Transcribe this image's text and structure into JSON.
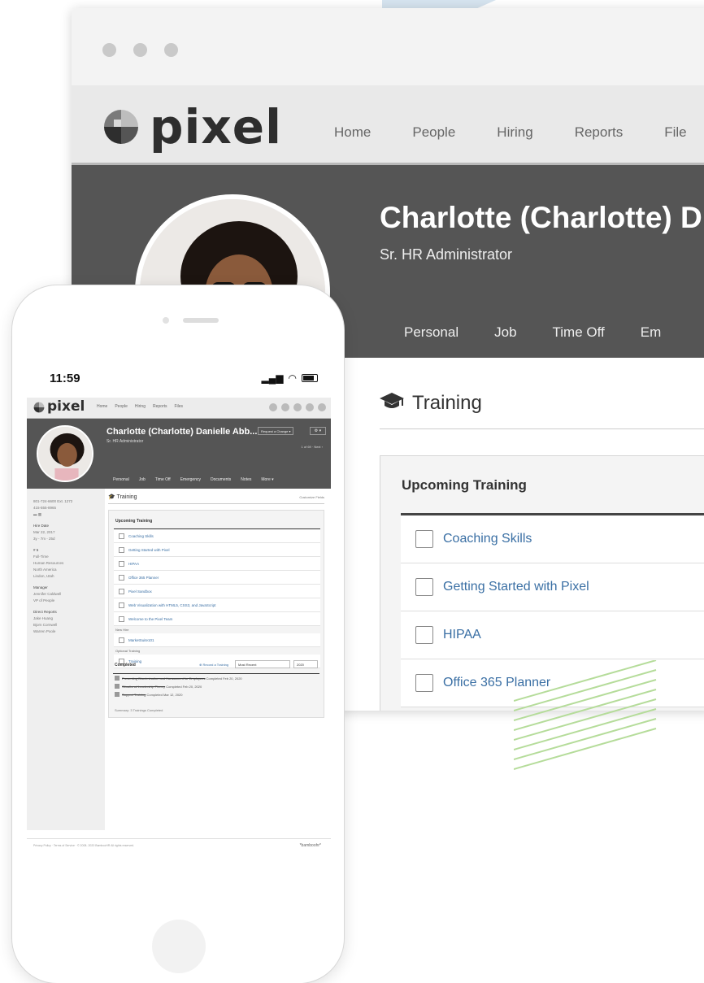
{
  "app": {
    "logo_text": "pixel"
  },
  "nav": {
    "items": [
      "Home",
      "People",
      "Hiring",
      "Reports",
      "File"
    ]
  },
  "employee": {
    "name": "Charlotte (Charlotte) D",
    "title": "Sr. HR Administrator",
    "tabs": [
      "Personal",
      "Job",
      "Time Off",
      "Em"
    ]
  },
  "training": {
    "section_title": "Training",
    "upcoming_title": "Upcoming Training",
    "items": [
      "Coaching Skills",
      "Getting Started with Pixel",
      "HIPAA",
      "Office 365 Planner"
    ]
  },
  "mobile": {
    "status_time": "11:59",
    "logo_text": "pixel",
    "nav_items": [
      "Home",
      "People",
      "Hiring",
      "Reports",
      "Files"
    ],
    "employee_name": "Charlotte (Charlotte) Danielle Abb...",
    "employee_title": "Sr. HR Administrator",
    "request_change": "Request a Change ▾",
    "gear_label": "⚙ ▾",
    "record_count": "1 of 69 · Next ›",
    "tabs": [
      "Personal",
      "Job",
      "Time Off",
      "Emergency",
      "Documents",
      "Notes",
      "More ▾"
    ],
    "sidebar": {
      "phone1": "801-724-6600  Ext. 1272",
      "phone2": "415-555-8965",
      "hire_date_label": "Hire Date",
      "hire_date": "Mar 22, 2017",
      "tenure": "3y - 7m - 25d",
      "emp_num": "# 5",
      "full_time": "Full-Time",
      "department": "Human Resources",
      "region": "North America",
      "location": "Lindon, Utah",
      "manager_label": "Manager",
      "manager_name": "Jennifer Caldwell",
      "manager_title": "VP of People",
      "direct_reports_label": "Direct Reports",
      "direct_reports": [
        "Jake Huang",
        "Bjorn Cornwell",
        "Warren Poole"
      ]
    },
    "training_title": "Training",
    "customize_fields": "Customize Fields",
    "upcoming_title": "Upcoming Training",
    "upcoming_items": [
      "Coaching Skills",
      "Getting Started with Pixel",
      "HIPAA",
      "Office 365 Planner",
      "Pixel Sandbox",
      "Web Visualization with HTML5, CSS3, and JavaScript",
      "Welcome to the Pixel Team"
    ],
    "new_hire_label": "New Hire",
    "new_hire_items": [
      "MarketSuite101"
    ],
    "optional_label": "Optional Training",
    "optional_items": [
      "Training"
    ],
    "completed_title": "Completed",
    "record_training": "⊕ Record a Training",
    "sort_select": "Most Recent",
    "year_select": "2020",
    "completed_items": [
      {
        "name": "Preventing Discrimination and Harassment for Employees",
        "date": "Completed Feb 20, 2020"
      },
      {
        "name": "Situational Leadership Theory",
        "date": "Completed Feb 20, 2020"
      },
      {
        "name": "Support Training",
        "date": "Completed Mar 12, 2020"
      }
    ],
    "summary": "Summary: 3 Trainings Completed",
    "footer_left": "Privacy Policy · Terms of Service · © 2008- 2020 BambooHR All rights reserved.",
    "footer_right": "*bamboohr*"
  },
  "colors": {
    "header_bg": "#555555",
    "nav_bg": "#e9e9e9",
    "link": "#3a6fa4",
    "accent_stripes": "#b5dc9a",
    "deco_triangle": "#d6e4ef"
  }
}
